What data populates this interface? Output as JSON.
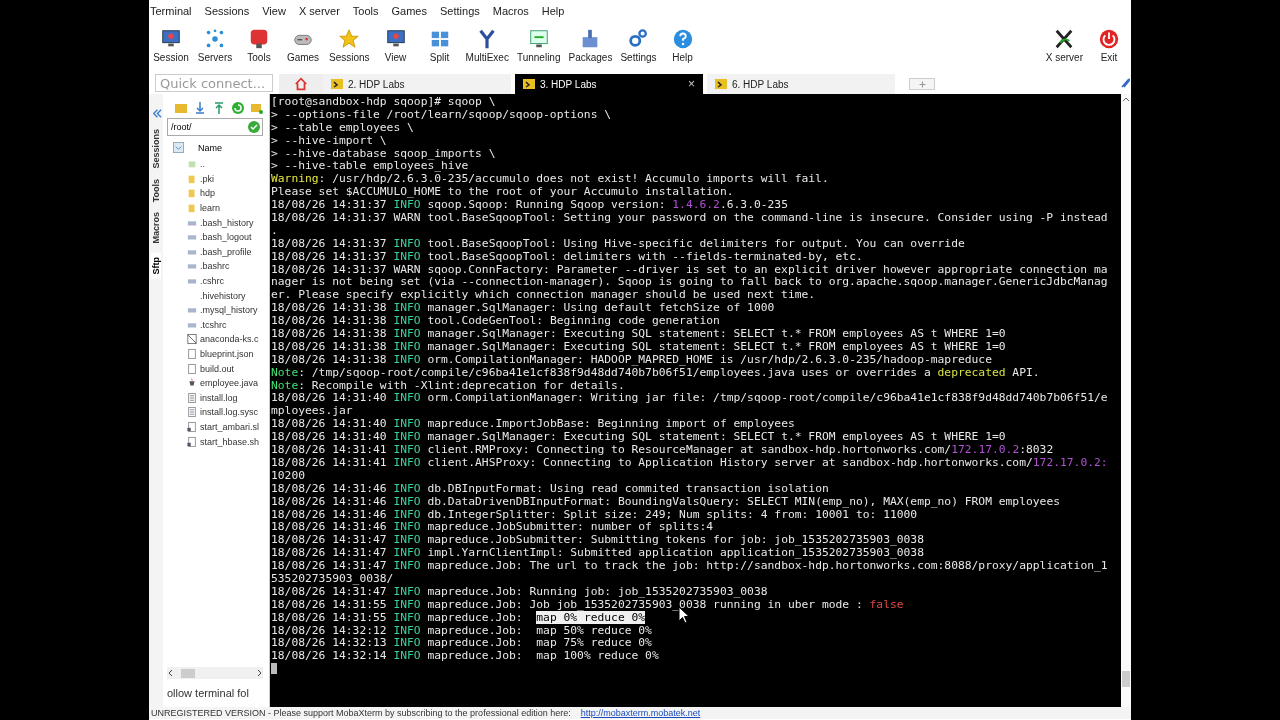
{
  "menu": [
    "Terminal",
    "Sessions",
    "View",
    "X server",
    "Tools",
    "Games",
    "Settings",
    "Macros",
    "Help"
  ],
  "toolbar": {
    "buttons": [
      "Session",
      "Servers",
      "Tools",
      "Games",
      "Sessions",
      "View",
      "Split",
      "MultiExec",
      "Tunneling",
      "Packages",
      "Settings",
      "Help"
    ],
    "right_buttons": [
      "X server",
      "Exit"
    ]
  },
  "quick_connect": {
    "placeholder": "Quick connect..."
  },
  "tabs": [
    {
      "label": "2. HDP Labs",
      "selected": false
    },
    {
      "label": "3. HDP Labs",
      "selected": true,
      "close": "×"
    },
    {
      "label": "6. HDP Labs",
      "selected": false
    }
  ],
  "side_tabs": [
    {
      "label": "Sessions",
      "selected": false
    },
    {
      "label": "Tools",
      "selected": false
    },
    {
      "label": "Macros",
      "selected": false
    },
    {
      "label": "Sftp",
      "selected": true
    }
  ],
  "sftp": {
    "path": "/root/",
    "column": "Name",
    "files": [
      {
        "name": "..",
        "kind": "parent"
      },
      {
        "name": ".pki",
        "kind": "folder"
      },
      {
        "name": "hdp",
        "kind": "folder"
      },
      {
        "name": "learn",
        "kind": "folder"
      },
      {
        "name": ".bash_history",
        "kind": "config"
      },
      {
        "name": ".bash_logout",
        "kind": "config"
      },
      {
        "name": ".bash_profile",
        "kind": "config"
      },
      {
        "name": ".bashrc",
        "kind": "config"
      },
      {
        "name": ".cshrc",
        "kind": "config"
      },
      {
        "name": ".hivehistory",
        "kind": "none"
      },
      {
        "name": ".mysql_history",
        "kind": "config"
      },
      {
        "name": ".tcshrc",
        "kind": "config"
      },
      {
        "name": "anaconda-ks.c",
        "kind": "crossed"
      },
      {
        "name": "blueprint.json",
        "kind": "blank"
      },
      {
        "name": "build.out",
        "kind": "blank"
      },
      {
        "name": "employee.java",
        "kind": "java"
      },
      {
        "name": "install.log",
        "kind": "text"
      },
      {
        "name": "install.log.sysc",
        "kind": "text"
      },
      {
        "name": "start_ambari.sl",
        "kind": "script"
      },
      {
        "name": "start_hbase.sh",
        "kind": "script"
      }
    ],
    "follow": "ollow terminal fol"
  },
  "terminal": {
    "lines": [
      {
        "parts": [
          {
            "text": "[root@sandbox-hdp sqoop]# sqoop \\",
            "kind": "plain"
          }
        ]
      },
      {
        "parts": [
          {
            "text": "> --options-file /root/learn/sqoop/sqoop-options \\",
            "kind": "plain"
          }
        ]
      },
      {
        "parts": [
          {
            "text": "> --table employees \\",
            "kind": "plain"
          }
        ]
      },
      {
        "parts": [
          {
            "text": "> --hive-import \\",
            "kind": "plain"
          }
        ]
      },
      {
        "parts": [
          {
            "text": "> --hive-database sqoop_imports \\",
            "kind": "plain"
          }
        ]
      },
      {
        "parts": [
          {
            "text": "> --hive-table employees_hive",
            "kind": "plain"
          }
        ]
      },
      {
        "parts": [
          {
            "text": "Warning",
            "kind": "warning"
          },
          {
            "text": ": /usr/hdp/2.6.3.0-235/accumulo does not exist! Accumulo imports will fail.",
            "kind": "plain"
          }
        ]
      },
      {
        "parts": [
          {
            "text": "Please set $ACCUMULO_HOME to the root of your Accumulo installation.",
            "kind": "plain"
          }
        ]
      },
      {
        "parts": [
          {
            "text": "18/08/26 14:31:37 ",
            "kind": "plain"
          },
          {
            "text": "INFO",
            "kind": "info"
          },
          {
            "text": " sqoop.Sqoop: Running Sqoop version: ",
            "kind": "plain"
          },
          {
            "text": "1.4.6.2",
            "kind": "number"
          },
          {
            "text": ".6.3.0-235",
            "kind": "plain"
          }
        ]
      },
      {
        "parts": [
          {
            "text": "18/08/26 14:31:37 WARN tool.BaseSqoopTool: Setting your password on the command-line is insecure. Consider using -P instead",
            "kind": "plain"
          }
        ]
      },
      {
        "parts": [
          {
            "text": ".",
            "kind": "plain"
          }
        ]
      },
      {
        "parts": [
          {
            "text": "18/08/26 14:31:37 ",
            "kind": "plain"
          },
          {
            "text": "INFO",
            "kind": "info"
          },
          {
            "text": " tool.BaseSqoopTool: Using Hive-specific delimiters for output. You can override",
            "kind": "plain"
          }
        ]
      },
      {
        "parts": [
          {
            "text": "18/08/26 14:31:37 ",
            "kind": "plain"
          },
          {
            "text": "INFO",
            "kind": "info"
          },
          {
            "text": " tool.BaseSqoopTool: delimiters with --fields-terminated-by, etc.",
            "kind": "plain"
          }
        ]
      },
      {
        "parts": [
          {
            "text": "18/08/26 14:31:37 WARN sqoop.ConnFactory: Parameter --driver is set to an explicit driver however appropriate connection ma",
            "kind": "plain"
          }
        ]
      },
      {
        "parts": [
          {
            "text": "nager is not being set (via --connection-manager). Sqoop is going to fall back to org.apache.sqoop.manager.GenericJdbcManag",
            "kind": "plain"
          }
        ]
      },
      {
        "parts": [
          {
            "text": "er. Please specify explicitly which connection manager should be used next time.",
            "kind": "plain"
          }
        ]
      },
      {
        "parts": [
          {
            "text": "18/08/26 14:31:38 ",
            "kind": "plain"
          },
          {
            "text": "INFO",
            "kind": "info"
          },
          {
            "text": " manager.SqlManager: Using default fetchSize of 1000",
            "kind": "plain"
          }
        ]
      },
      {
        "parts": [
          {
            "text": "18/08/26 14:31:38 ",
            "kind": "plain"
          },
          {
            "text": "INFO",
            "kind": "info"
          },
          {
            "text": " tool.CodeGenTool: Beginning code generation",
            "kind": "plain"
          }
        ]
      },
      {
        "parts": [
          {
            "text": "18/08/26 14:31:38 ",
            "kind": "plain"
          },
          {
            "text": "INFO",
            "kind": "info"
          },
          {
            "text": " manager.SqlManager: Executing SQL statement: SELECT t.* FROM employees AS t WHERE 1=0",
            "kind": "plain"
          }
        ]
      },
      {
        "parts": [
          {
            "text": "18/08/26 14:31:38 ",
            "kind": "plain"
          },
          {
            "text": "INFO",
            "kind": "info"
          },
          {
            "text": " manager.SqlManager: Executing SQL statement: SELECT t.* FROM employees AS t WHERE 1=0",
            "kind": "plain"
          }
        ]
      },
      {
        "parts": [
          {
            "text": "18/08/26 14:31:38 ",
            "kind": "plain"
          },
          {
            "text": "INFO",
            "kind": "info"
          },
          {
            "text": " orm.CompilationManager: HADOOP_MAPRED_HOME is /usr/hdp/2.6.3.0-235/hadoop-mapreduce",
            "kind": "plain"
          }
        ]
      },
      {
        "parts": [
          {
            "text": "Note",
            "kind": "note"
          },
          {
            "text": ": /tmp/sqoop-root/compile/c96ba41e1cf838f9d48dd740b7b06f51/employees.java uses or overrides a ",
            "kind": "plain"
          },
          {
            "text": "deprecated",
            "kind": "deprecated"
          },
          {
            "text": " API.",
            "kind": "plain"
          }
        ]
      },
      {
        "parts": [
          {
            "text": "Note",
            "kind": "note"
          },
          {
            "text": ": Recompile with -Xlint:deprecation for details.",
            "kind": "plain"
          }
        ]
      },
      {
        "parts": [
          {
            "text": "18/08/26 14:31:40 ",
            "kind": "plain"
          },
          {
            "text": "INFO",
            "kind": "info"
          },
          {
            "text": " orm.CompilationManager: Writing jar file: /tmp/sqoop-root/compile/c96ba41e1cf838f9d48dd740b7b06f51/e",
            "kind": "plain"
          }
        ]
      },
      {
        "parts": [
          {
            "text": "mployees.jar",
            "kind": "plain"
          }
        ]
      },
      {
        "parts": [
          {
            "text": "18/08/26 14:31:40 ",
            "kind": "plain"
          },
          {
            "text": "INFO",
            "kind": "info"
          },
          {
            "text": " mapreduce.ImportJobBase: Beginning import of employees",
            "kind": "plain"
          }
        ]
      },
      {
        "parts": [
          {
            "text": "18/08/26 14:31:40 ",
            "kind": "plain"
          },
          {
            "text": "INFO",
            "kind": "info"
          },
          {
            "text": " manager.SqlManager: Executing SQL statement: SELECT t.* FROM employees AS t WHERE 1=0",
            "kind": "plain"
          }
        ]
      },
      {
        "parts": [
          {
            "text": "18/08/26 14:31:41 ",
            "kind": "plain"
          },
          {
            "text": "INFO",
            "kind": "info"
          },
          {
            "text": " client.RMProxy: Connecting to ResourceManager at sandbox-hdp.hortonworks.com/",
            "kind": "plain"
          },
          {
            "text": "172.17.0.2",
            "kind": "number"
          },
          {
            "text": ":8032",
            "kind": "plain"
          }
        ]
      },
      {
        "parts": [
          {
            "text": "18/08/26 14:31:41 ",
            "kind": "plain"
          },
          {
            "text": "INFO",
            "kind": "info"
          },
          {
            "text": " client.AHSProxy: Connecting to Application History server at sandbox-hdp.hortonworks.com/",
            "kind": "plain"
          },
          {
            "text": "172.17.0.2:",
            "kind": "number"
          }
        ]
      },
      {
        "parts": [
          {
            "text": "10200",
            "kind": "plain"
          }
        ]
      },
      {
        "parts": [
          {
            "text": "18/08/26 14:31:46 ",
            "kind": "plain"
          },
          {
            "text": "INFO",
            "kind": "info"
          },
          {
            "text": " db.DBInputFormat: Using read commited transaction isolation",
            "kind": "plain"
          }
        ]
      },
      {
        "parts": [
          {
            "text": "18/08/26 14:31:46 ",
            "kind": "plain"
          },
          {
            "text": "INFO",
            "kind": "info"
          },
          {
            "text": " db.DataDrivenDBInputFormat: BoundingValsQuery: SELECT MIN(emp_no), MAX(emp_no) FROM employees",
            "kind": "plain"
          }
        ]
      },
      {
        "parts": [
          {
            "text": "18/08/26 14:31:46 ",
            "kind": "plain"
          },
          {
            "text": "INFO",
            "kind": "info"
          },
          {
            "text": " db.IntegerSplitter: Split size: 249; Num splits: 4 from: 10001 to: 11000",
            "kind": "plain"
          }
        ]
      },
      {
        "parts": [
          {
            "text": "18/08/26 14:31:46 ",
            "kind": "plain"
          },
          {
            "text": "INFO",
            "kind": "info"
          },
          {
            "text": " mapreduce.JobSubmitter: number of splits:4",
            "kind": "plain"
          }
        ]
      },
      {
        "parts": [
          {
            "text": "18/08/26 14:31:47 ",
            "kind": "plain"
          },
          {
            "text": "INFO",
            "kind": "info"
          },
          {
            "text": " mapreduce.JobSubmitter: Submitting tokens for job: job_1535202735903_0038",
            "kind": "plain"
          }
        ]
      },
      {
        "parts": [
          {
            "text": "18/08/26 14:31:47 ",
            "kind": "plain"
          },
          {
            "text": "INFO",
            "kind": "info"
          },
          {
            "text": " impl.YarnClientImpl: Submitted application application_1535202735903_0038",
            "kind": "plain"
          }
        ]
      },
      {
        "parts": [
          {
            "text": "18/08/26 14:31:47 ",
            "kind": "plain"
          },
          {
            "text": "INFO",
            "kind": "info"
          },
          {
            "text": " mapreduce.Job: The url to track the job: http://sandbox-hdp.hortonworks.com:8088/proxy/application_1",
            "kind": "plain"
          }
        ]
      },
      {
        "parts": [
          {
            "text": "535202735903_0038/",
            "kind": "plain"
          }
        ]
      },
      {
        "parts": [
          {
            "text": "18/08/26 14:31:47 ",
            "kind": "plain"
          },
          {
            "text": "INFO",
            "kind": "info"
          },
          {
            "text": " mapreduce.Job: Running job: job_1535202735903_0038",
            "kind": "plain"
          }
        ]
      },
      {
        "parts": [
          {
            "text": "18/08/26 14:31:55 ",
            "kind": "plain"
          },
          {
            "text": "INFO",
            "kind": "info"
          },
          {
            "text": " mapreduce.Job: Job job_1535202735903_0038 running in uber mode : ",
            "kind": "plain"
          },
          {
            "text": "false",
            "kind": "false"
          }
        ]
      },
      {
        "parts": [
          {
            "text": "18/08/26 14:31:55 ",
            "kind": "plain"
          },
          {
            "text": "INFO",
            "kind": "info"
          },
          {
            "text": " mapreduce.Job:  ",
            "kind": "plain"
          },
          {
            "text": "map 0% reduce 0%",
            "kind": "selected"
          }
        ]
      },
      {
        "parts": [
          {
            "text": "18/08/26 14:32:12 ",
            "kind": "plain"
          },
          {
            "text": "INFO",
            "kind": "info"
          },
          {
            "text": " mapreduce.Job:  map 50% reduce 0%",
            "kind": "plain"
          }
        ]
      },
      {
        "parts": [
          {
            "text": "18/08/26 14:32:13 ",
            "kind": "plain"
          },
          {
            "text": "INFO",
            "kind": "info"
          },
          {
            "text": " mapreduce.Job:  map 75% reduce 0%",
            "kind": "plain"
          }
        ]
      },
      {
        "parts": [
          {
            "text": "18/08/26 14:32:14 ",
            "kind": "plain"
          },
          {
            "text": "INFO",
            "kind": "info"
          },
          {
            "text": " mapreduce.Job:  map 100% reduce 0%",
            "kind": "plain"
          }
        ]
      }
    ]
  },
  "status_bar": {
    "text": "UNREGISTERED VERSION  -  Please support MobaXterm by subscribing to the professional edition here:",
    "link": "http://mobaxterm.mobatek.net"
  }
}
